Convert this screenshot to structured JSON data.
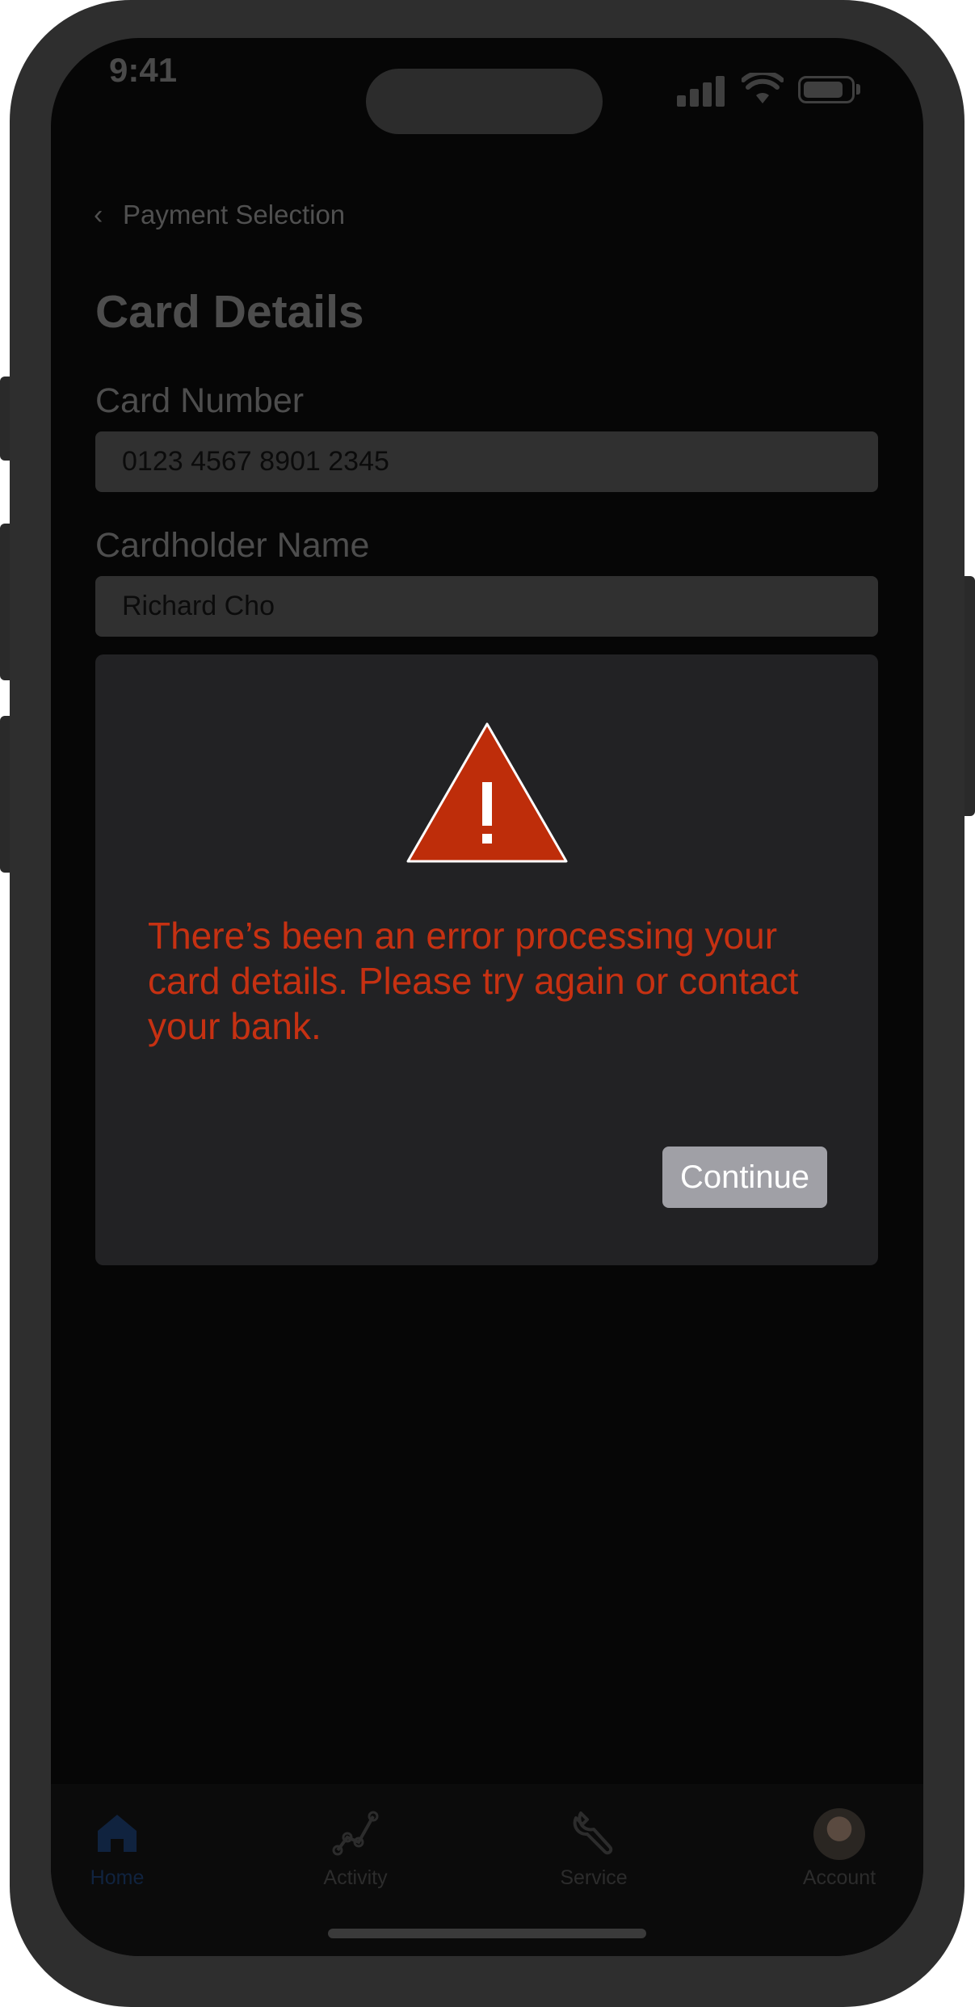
{
  "status_bar": {
    "time": "9:41"
  },
  "header": {
    "back_label": "Payment Selection",
    "title": "Card Details"
  },
  "form": {
    "card_number_label": "Card Number",
    "card_number_value": "0123 4567 8901 2345",
    "cardholder_label": "Cardholder Name",
    "cardholder_value": "Richard Cho"
  },
  "error_modal": {
    "icon": "warning-icon",
    "message": "There’s been an error processing your card details. Please try again or contact your bank.",
    "continue_label": "Continue"
  },
  "tab_bar": {
    "items": [
      {
        "label": "Home",
        "icon": "home-icon",
        "active": true
      },
      {
        "label": "Activity",
        "icon": "activity-icon"
      },
      {
        "label": "Service",
        "icon": "wrench-icon"
      },
      {
        "label": "Account",
        "icon": "avatar"
      }
    ]
  },
  "colors": {
    "error": "#c63112",
    "active_tab": "#10233f",
    "modal_bg": "#222224",
    "button": "#a0a0a6"
  }
}
